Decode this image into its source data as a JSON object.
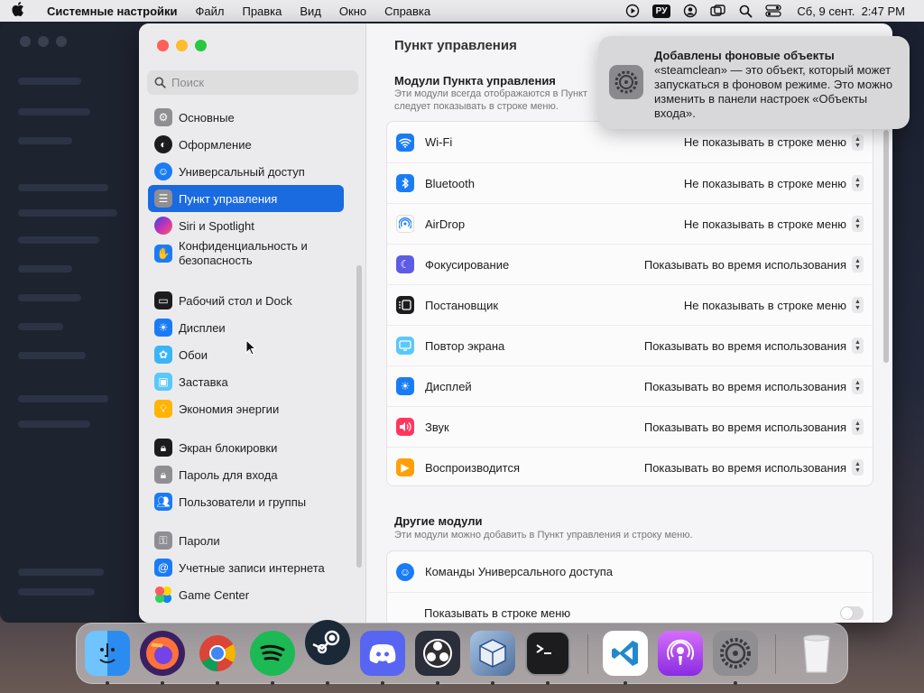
{
  "menubar": {
    "app": "Системные настройки",
    "menus": [
      "Файл",
      "Правка",
      "Вид",
      "Окно",
      "Справка"
    ],
    "input_source": "РУ",
    "datetime": "Сб, 9 сент.  2:47 PM"
  },
  "sidebar": {
    "search_placeholder": "Поиск",
    "items": [
      {
        "label": "Основные",
        "color": "#8e8e93"
      },
      {
        "label": "Оформление",
        "color": "#1c1c1e"
      },
      {
        "label": "Универсальный доступ",
        "color": "#1a7cf5"
      },
      {
        "label": "Пункт управления",
        "color": "#8e8e93"
      },
      {
        "label": "Siri и Spotlight",
        "color": "#c032b8"
      },
      {
        "label": "Конфиденциальность и безопасность",
        "color": "#1a7cf5"
      },
      {
        "label": "Рабочий стол и Dock",
        "color": "#1c1c1e"
      },
      {
        "label": "Дисплеи",
        "color": "#1a7cf5"
      },
      {
        "label": "Обои",
        "color": "#38b6f5"
      },
      {
        "label": "Заставка",
        "color": "#5ac8fa"
      },
      {
        "label": "Экономия энергии",
        "color": "#ffb400"
      },
      {
        "label": "Экран блокировки",
        "color": "#1c1c1e"
      },
      {
        "label": "Пароль для входа",
        "color": "#8e8e93"
      },
      {
        "label": "Пользователи и группы",
        "color": "#1a7cf5"
      },
      {
        "label": "Пароли",
        "color": "#8e8e93"
      },
      {
        "label": "Учетные записи интернета",
        "color": "#1a7cf5"
      },
      {
        "label": "Game Center",
        "color": "#ffffff"
      }
    ]
  },
  "content": {
    "title": "Пункт управления",
    "section1_title": "Модули Пункта управления",
    "section1_sub_line1": "Эти модули всегда отображаются в Пункт",
    "section1_sub_line2": "следует показывать в строке меню.",
    "modules": [
      {
        "label": "Wi-Fi",
        "value": "Не показывать в строке меню",
        "color": "#1a7cf5"
      },
      {
        "label": "Bluetooth",
        "value": "Не показывать в строке меню",
        "color": "#1a7cf5"
      },
      {
        "label": "AirDrop",
        "value": "Не показывать в строке меню",
        "color": "#ffffff"
      },
      {
        "label": "Фокусирование",
        "value": "Показывать во время использования",
        "color": "#5e5ce6"
      },
      {
        "label": "Постановщик",
        "value": "Не показывать в строке меню",
        "color": "#1c1c1e"
      },
      {
        "label": "Повтор экрана",
        "value": "Показывать во время использования",
        "color": "#5ac8fa"
      },
      {
        "label": "Дисплей",
        "value": "Показывать во время использования",
        "color": "#1a7cf5"
      },
      {
        "label": "Звук",
        "value": "Показывать во время использования",
        "color": "#ff375f"
      },
      {
        "label": "Воспроизводится",
        "value": "Показывать во время использования",
        "color": "#ff9f0a"
      }
    ],
    "section2_title": "Другие модули",
    "section2_sub": "Эти модули можно добавить в Пункт управления и строку меню.",
    "other": {
      "label": "Команды Универсального доступа",
      "toggle_label": "Показывать в строке меню",
      "color": "#1a7cf5"
    }
  },
  "notification": {
    "title": "Добавлены фоновые объекты",
    "body": "«steamclean» — это объект, который может запускаться в фоновом режиме. Это можно изменить в панели настроек «Объекты входа»."
  },
  "dock": {
    "apps": [
      {
        "name": "finder",
        "color": "#2a8cf0",
        "running": true
      },
      {
        "name": "firefox",
        "color": "#3b1f63",
        "running": true
      },
      {
        "name": "chrome",
        "color": "#ffffff",
        "running": true
      },
      {
        "name": "spotify",
        "color": "#1db954",
        "running": true
      },
      {
        "name": "steam",
        "color": "#1b2838",
        "running": true
      },
      {
        "name": "discord",
        "color": "#5865f2",
        "running": true
      },
      {
        "name": "obs",
        "color": "#2b2e3b",
        "running": true
      },
      {
        "name": "virtualbox",
        "color": "#6d8db5",
        "running": true
      },
      {
        "name": "terminal",
        "color": "#1c1c1e",
        "running": true
      },
      {
        "name": "vscode",
        "color": "#ffffff",
        "running": true
      },
      {
        "name": "podcasts",
        "color": "#a73de0",
        "running": false
      },
      {
        "name": "system-settings",
        "color": "#8e8e93",
        "running": true
      },
      {
        "name": "trash",
        "color": "#e8e8ea",
        "running": false
      }
    ]
  }
}
